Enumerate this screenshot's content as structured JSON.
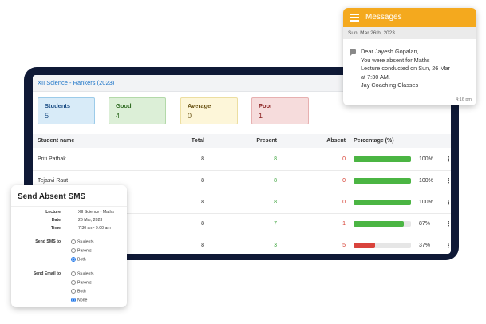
{
  "screen": {
    "class_title": "XII Science - Rankers (2023)",
    "cards": [
      {
        "label": "Students",
        "value": "5"
      },
      {
        "label": "Good",
        "value": "4"
      },
      {
        "label": "Average",
        "value": "0"
      },
      {
        "label": "Poor",
        "value": "1"
      }
    ],
    "headers": {
      "name": "Student name",
      "total": "Total",
      "present": "Present",
      "absent": "Absent",
      "percentage": "Percentage (%)"
    },
    "rows": [
      {
        "name": "Priti Pathak",
        "total": "8",
        "present": "8",
        "absent": "0",
        "pct": "100%",
        "fill": 100,
        "color": "#4bb543"
      },
      {
        "name": "Tejasvi Raut",
        "total": "8",
        "present": "8",
        "absent": "0",
        "pct": "100%",
        "fill": 100,
        "color": "#4bb543"
      },
      {
        "name": "",
        "total": "8",
        "present": "8",
        "absent": "0",
        "pct": "100%",
        "fill": 100,
        "color": "#4bb543"
      },
      {
        "name": "",
        "total": "8",
        "present": "7",
        "absent": "1",
        "pct": "87%",
        "fill": 87,
        "color": "#4bb543"
      },
      {
        "name": "",
        "total": "8",
        "present": "3",
        "absent": "5",
        "pct": "37%",
        "fill": 37,
        "color": "#d9433c"
      }
    ],
    "menu_glyph": "⋮"
  },
  "messages": {
    "title": "Messages",
    "date": "Sun, Mar 26th, 2023",
    "lines": [
      "Dear Jayesh Gopalan,",
      "You were absent for Maths",
      "Lecture conducted on Sun, 26 Mar",
      "at  7:30 AM.",
      "Jay Coaching Classes"
    ],
    "time": "4:16 pm",
    "header_color": "#f4a91e"
  },
  "sms": {
    "title": "Send Absent SMS",
    "lecture_label": "Lecture",
    "lecture": "XII Science - Maths",
    "date_label": "Date",
    "date": "26 Mar, 2023",
    "time_label": "Time",
    "time": "7:30 am- 9:00 am",
    "sms_to_label": "Send SMS to",
    "sms_options": [
      "Students",
      "Parents",
      "Both"
    ],
    "sms_selected": 2,
    "email_to_label": "Send Email to",
    "email_options": [
      "Students",
      "Parents",
      "Both",
      "None"
    ],
    "email_selected": 3
  }
}
